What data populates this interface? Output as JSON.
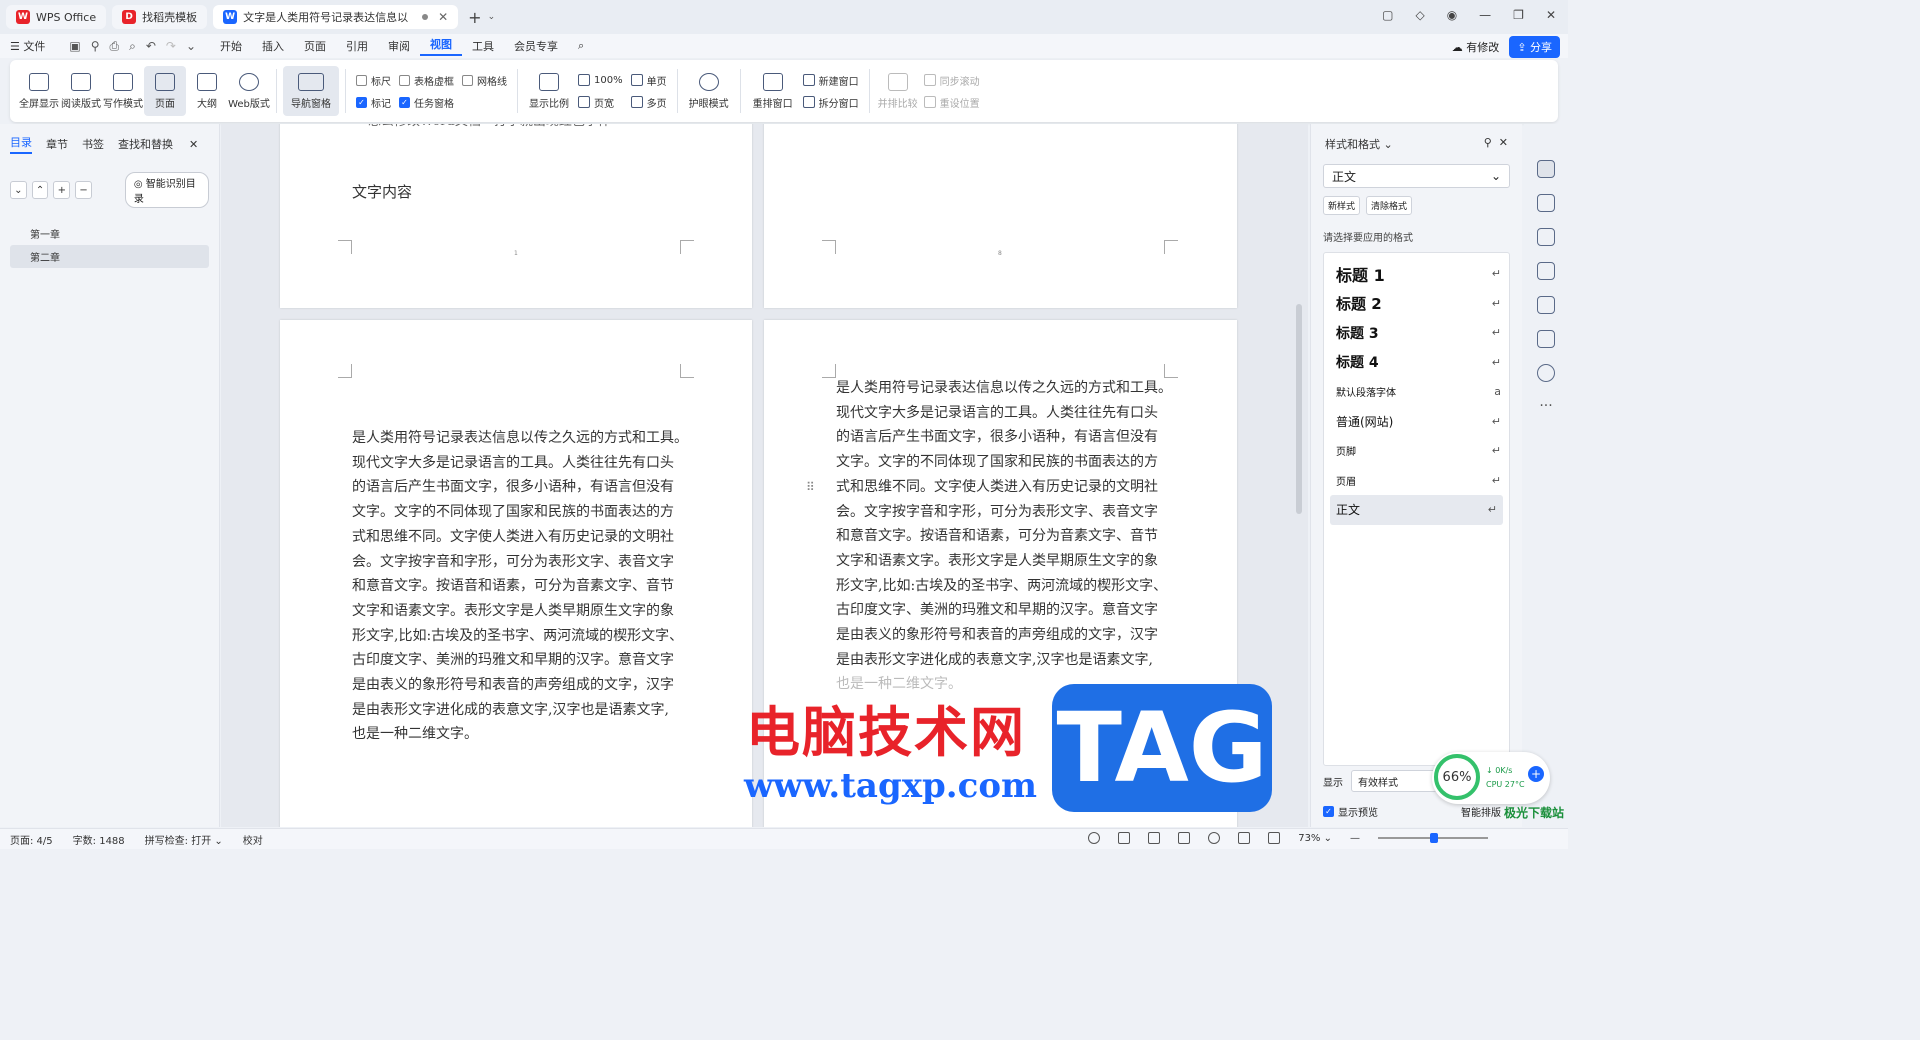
{
  "tabs": [
    {
      "label": "WPS Office",
      "logo_color": "#e8232a",
      "logo_text": "W"
    },
    {
      "label": "找稻壳模板",
      "logo_color": "#e8232a",
      "logo_text": "D"
    },
    {
      "label": "文字是人类用符号记录表达信息以",
      "logo_color": "#1a66ff",
      "logo_text": "W"
    }
  ],
  "menu": {
    "file": "文件",
    "items": [
      "开始",
      "插入",
      "页面",
      "引用",
      "审阅",
      "视图",
      "工具",
      "会员专享"
    ],
    "active": "视图",
    "modified": "有修改",
    "share": "分享"
  },
  "ribbon": {
    "view_buttons": [
      "全屏显示",
      "阅读版式",
      "写作模式",
      "页面",
      "大纲",
      "Web版式"
    ],
    "nav_pane": "导航窗格",
    "checks": [
      {
        "label": "标尺",
        "checked": false
      },
      {
        "label": "表格虚框",
        "checked": false
      },
      {
        "label": "网格线",
        "checked": false
      },
      {
        "label": "标记",
        "checked": true
      },
      {
        "label": "任务窗格",
        "checked": true
      }
    ],
    "zoom": {
      "ratio": "显示比例",
      "hundred": "100%",
      "width": "页宽",
      "single": "单页",
      "multi": "多页"
    },
    "eye": "护眼模式",
    "rearrange": "重排窗口",
    "new_window": "新建窗口",
    "split_window": "拆分窗口",
    "side_by_side": "并排比较",
    "sync_scroll": "同步滚动",
    "reset_pos": "重设位置"
  },
  "leftpanel": {
    "tabs": [
      "目录",
      "章节",
      "书签",
      "查找和替换"
    ],
    "smart_toc": "智能识别目录",
    "items": [
      "第一章",
      "第二章"
    ],
    "selected": "第二章"
  },
  "doc": {
    "page1_top_text": "思公修改Word文档一打字就出现红色字体",
    "page1_heading": "文字内容",
    "page1_num": "1",
    "page2_num": "8",
    "body_lines_left": [
      "是人类用符号记录表达信息以传之久远的方式和工具。",
      "现代文字大多是记录语言的工具。人类往往先有口头",
      "的语言后产生书面文字，很多小语种，有语言但没有",
      "文字。文字的不同体现了国家和民族的书面表达的方",
      "式和思维不同。文字使人类进入有历史记录的文明社",
      "会。文字按字音和字形，可分为表形文字、表音文字",
      "和意音文字。按语音和语素，可分为音素文字、音节",
      "文字和语素文字。表形文字是人类早期原生文字的象",
      "形文字,比如:古埃及的圣书字、两河流域的楔形文字、",
      "古印度文字、美洲的玛雅文和早期的汉字。意音文字",
      "是由表义的象形符号和表音的声旁组成的文字，汉字",
      "是由表形文字进化成的表意文字,汉字也是语素文字,",
      "也是一种二维文字。"
    ],
    "body_lines_right": [
      "是人类用符号记录表达信息以传之久远的方式和工具。",
      "现代文字大多是记录语言的工具。人类往往先有口头",
      "的语言后产生书面文字，很多小语种，有语言但没有",
      "文字。文字的不同体现了国家和民族的书面表达的方",
      "式和思维不同。文字使人类进入有历史记录的文明社",
      "会。文字按字音和字形，可分为表形文字、表音文字",
      "和意音文字。按语音和语素，可分为音素文字、音节",
      "文字和语素文字。表形文字是人类早期原生文字的象",
      "形文字,比如:古埃及的圣书字、两河流域的楔形文字、",
      "古印度文字、美洲的玛雅文和早期的汉字。意音文字",
      "是由表义的象形符号和表音的声旁组成的文字，汉字",
      "是由表形文字进化成的表意文字,汉字也是语素文字,",
      "也是一种二维文字。"
    ]
  },
  "watermark": {
    "cn": "电脑技术网",
    "url": "www.tagxp.com",
    "tag": "TAG"
  },
  "rightpanel": {
    "title": "样式和格式",
    "current": "正文",
    "new_style": "新样式",
    "clear_format": "清除格式",
    "choose_label": "请选择要应用的格式",
    "styles": [
      {
        "name": "标题  1",
        "weight": "bold",
        "size": "16px"
      },
      {
        "name": "标题  2",
        "weight": "bold",
        "size": "15px"
      },
      {
        "name": "标题  3",
        "weight": "bold",
        "size": "14px"
      },
      {
        "name": "标题  4",
        "weight": "bold",
        "size": "14px"
      },
      {
        "name": "默认段落字体",
        "weight": "normal",
        "size": "10px"
      },
      {
        "name": "普通(网站)",
        "weight": "normal",
        "size": "12px"
      },
      {
        "name": "页脚",
        "weight": "normal",
        "size": "10px"
      },
      {
        "name": "页眉",
        "weight": "normal",
        "size": "10px"
      },
      {
        "name": "正文",
        "weight": "normal",
        "size": "12px"
      }
    ],
    "selected_style": "正文",
    "show_label": "显示",
    "show_value": "有效样式",
    "preview_label": "显示预览",
    "smart_typeset": "智能排版"
  },
  "perf": {
    "percent": "66%",
    "net": "0K/s",
    "cpu": "CPU 27°C"
  },
  "status": {
    "page": "页面: 4/5",
    "words": "字数: 1488",
    "spell": "拼写检查: 打开",
    "proof": "校对",
    "zoom": "73%"
  },
  "brand_corner": "极光下载站"
}
